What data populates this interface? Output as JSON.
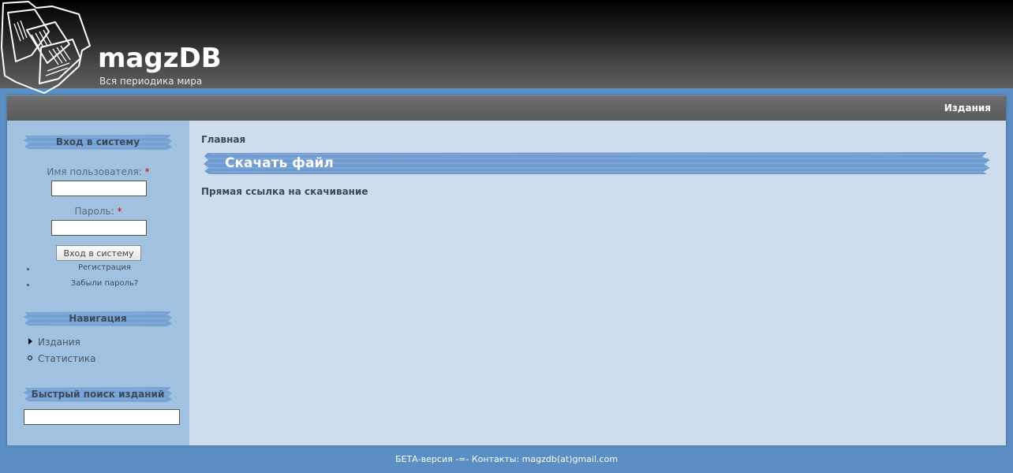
{
  "header": {
    "site_name": "magzDB",
    "slogan": "Вся периодика мира",
    "logo_icon": "newspaper-logo-icon"
  },
  "navbar": {
    "items": [
      {
        "label": "Издания"
      }
    ]
  },
  "sidebar": {
    "login": {
      "title": "Вход в систему",
      "username_label": "Имя пользователя:",
      "username_value": "",
      "password_label": "Пароль:",
      "password_value": "",
      "required_mark": "*",
      "submit_label": "Вход в систему",
      "links": [
        {
          "label": "Регистрация"
        },
        {
          "label": "Забыли пароль?"
        }
      ]
    },
    "navigation": {
      "title": "Навигация",
      "items": [
        {
          "label": "Издания",
          "icon": "arrow-right-icon"
        },
        {
          "label": "Статистика",
          "icon": "circle-bullet-icon"
        }
      ]
    },
    "search": {
      "title": "Быстрый поиск изданий",
      "value": ""
    }
  },
  "content": {
    "breadcrumb": "Главная",
    "title": "Скачать файл",
    "direct_link": "Прямая ссылка на скачивание"
  },
  "footer": {
    "text": "БЕТА-версия -=- Контакты: magzdb(at)gmail.com"
  },
  "colors": {
    "page_bg": "#5b8ec3",
    "sidebar_bg": "#a0c1e0",
    "content_bg": "#d0ddee",
    "title_band": "#6f9bd0"
  }
}
